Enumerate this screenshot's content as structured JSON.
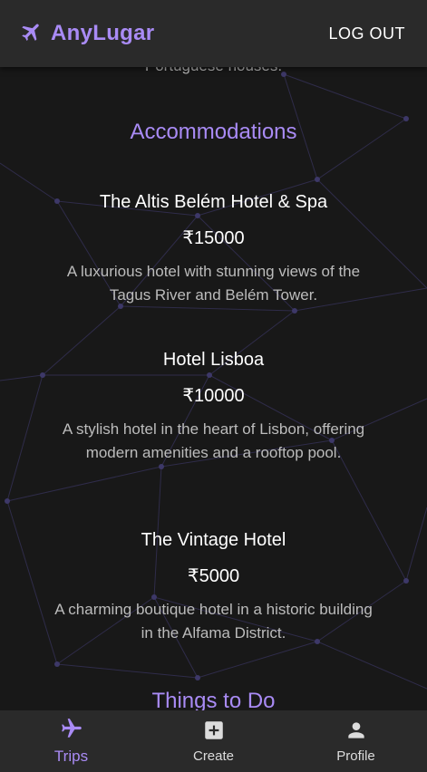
{
  "header": {
    "brand_icon": "airplane-icon",
    "brand_name": "AnyLugar",
    "logout_label": "LOG OUT"
  },
  "content": {
    "cut_text": "Portuguese houses.",
    "accommodations_title": "Accommodations",
    "accommodations": [
      {
        "name": "The Altis Belém Hotel & Spa",
        "price": "₹15000",
        "description": "A luxurious hotel with stunning views of the Tagus River and Belém Tower."
      },
      {
        "name": "Hotel Lisboa",
        "price": "₹10000",
        "description": "A stylish hotel in the heart of Lisbon, offering modern amenities and a rooftop pool."
      },
      {
        "name": "The Vintage Hotel",
        "price": "₹5000",
        "description": "A charming boutique hotel in a historic building in the Alfama District."
      }
    ],
    "things_title": "Things to Do"
  },
  "bottom_nav": {
    "items": [
      {
        "label": "Trips",
        "icon": "airplane-icon",
        "active": true
      },
      {
        "label": "Create",
        "icon": "add-box-icon",
        "active": false
      },
      {
        "label": "Profile",
        "icon": "person-icon",
        "active": false
      }
    ]
  },
  "colors": {
    "accent": "#a98bf5",
    "background": "#181818",
    "bar": "#2a2a2a",
    "network": "#3a3560"
  }
}
